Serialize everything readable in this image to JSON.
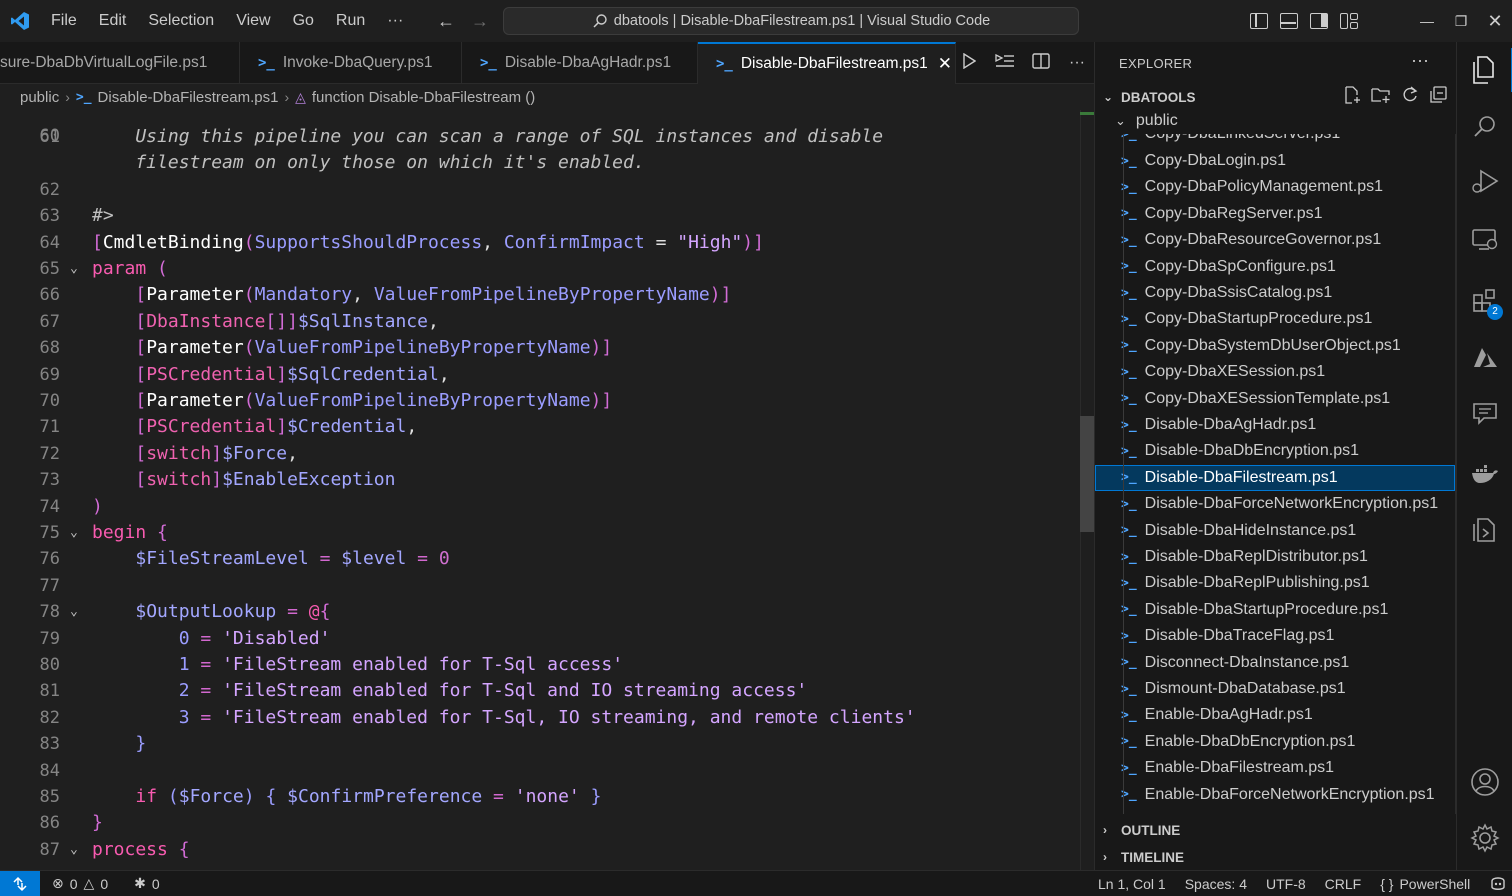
{
  "window": {
    "title": "dbatools | Disable-DbaFilestream.ps1 | Visual Studio Code",
    "menu": [
      "File",
      "Edit",
      "Selection",
      "View",
      "Go",
      "Run",
      "···"
    ]
  },
  "tabs": [
    {
      "label": "sure-DbaDbVirtualLogFile.ps1",
      "active": false
    },
    {
      "label": "Invoke-DbaQuery.ps1",
      "active": false
    },
    {
      "label": "Disable-DbaAgHadr.ps1",
      "active": false
    },
    {
      "label": "Disable-DbaFilestream.ps1",
      "active": true
    }
  ],
  "breadcrumb": {
    "folder": "public",
    "file": "Disable-DbaFilestream.ps1",
    "symbol": "function Disable-DbaFilestream ()"
  },
  "editor": {
    "partial_top_line": "60",
    "lines": [
      {
        "n": "61",
        "fold": false,
        "tokens": [
          [
            "c-comment",
            "    Using this pipeline you can scan a range of SQL instances and disable"
          ]
        ]
      },
      {
        "n": "",
        "fold": false,
        "tokens": [
          [
            "c-comment",
            "    filestream on only those on which it's enabled."
          ]
        ]
      },
      {
        "n": "62",
        "fold": false,
        "tokens": []
      },
      {
        "n": "63",
        "fold": false,
        "tokens": [
          [
            "c-comment",
            "#>"
          ]
        ]
      },
      {
        "n": "64",
        "fold": false,
        "tokens": [
          [
            "c-bracket",
            "["
          ],
          [
            "c-type",
            "CmdletBinding"
          ],
          [
            "c-bracket",
            "("
          ],
          [
            "c-attr",
            "SupportsShouldProcess"
          ],
          [
            "c-punct",
            ", "
          ],
          [
            "c-attr",
            "ConfirmImpact"
          ],
          [
            "c-punct",
            " = "
          ],
          [
            "c-str",
            "\"High\""
          ],
          [
            "c-bracket",
            ")]"
          ]
        ]
      },
      {
        "n": "65",
        "fold": true,
        "tokens": [
          [
            "c-kw",
            "param"
          ],
          [
            "c-punct",
            " "
          ],
          [
            "c-bracket",
            "("
          ]
        ]
      },
      {
        "n": "66",
        "fold": false,
        "tokens": [
          [
            "c-plain",
            "    "
          ],
          [
            "c-bracket",
            "["
          ],
          [
            "c-type",
            "Parameter"
          ],
          [
            "c-bracket",
            "("
          ],
          [
            "c-attr",
            "Mandatory"
          ],
          [
            "c-punct",
            ", "
          ],
          [
            "c-attr",
            "ValueFromPipelineByPropertyName"
          ],
          [
            "c-bracket",
            ")]"
          ]
        ]
      },
      {
        "n": "67",
        "fold": false,
        "tokens": [
          [
            "c-plain",
            "    "
          ],
          [
            "c-bracket",
            "["
          ],
          [
            "c-type2",
            "DbaInstance"
          ],
          [
            "c-bracket",
            "[]]"
          ],
          [
            "c-var",
            "$SqlInstance"
          ],
          [
            "c-punct",
            ","
          ]
        ]
      },
      {
        "n": "68",
        "fold": false,
        "tokens": [
          [
            "c-plain",
            "    "
          ],
          [
            "c-bracket",
            "["
          ],
          [
            "c-type",
            "Parameter"
          ],
          [
            "c-bracket",
            "("
          ],
          [
            "c-attr",
            "ValueFromPipelineByPropertyName"
          ],
          [
            "c-bracket",
            ")]"
          ]
        ]
      },
      {
        "n": "69",
        "fold": false,
        "tokens": [
          [
            "c-plain",
            "    "
          ],
          [
            "c-bracket",
            "["
          ],
          [
            "c-type2",
            "PSCredential"
          ],
          [
            "c-bracket",
            "]"
          ],
          [
            "c-var",
            "$SqlCredential"
          ],
          [
            "c-punct",
            ","
          ]
        ]
      },
      {
        "n": "70",
        "fold": false,
        "tokens": [
          [
            "c-plain",
            "    "
          ],
          [
            "c-bracket",
            "["
          ],
          [
            "c-type",
            "Parameter"
          ],
          [
            "c-bracket",
            "("
          ],
          [
            "c-attr",
            "ValueFromPipelineByPropertyName"
          ],
          [
            "c-bracket",
            ")]"
          ]
        ]
      },
      {
        "n": "71",
        "fold": false,
        "tokens": [
          [
            "c-plain",
            "    "
          ],
          [
            "c-bracket",
            "["
          ],
          [
            "c-type2",
            "PSCredential"
          ],
          [
            "c-bracket",
            "]"
          ],
          [
            "c-var",
            "$Credential"
          ],
          [
            "c-punct",
            ","
          ]
        ]
      },
      {
        "n": "72",
        "fold": false,
        "tokens": [
          [
            "c-plain",
            "    "
          ],
          [
            "c-bracket",
            "["
          ],
          [
            "c-type2",
            "switch"
          ],
          [
            "c-bracket",
            "]"
          ],
          [
            "c-var",
            "$Force"
          ],
          [
            "c-punct",
            ","
          ]
        ]
      },
      {
        "n": "73",
        "fold": false,
        "tokens": [
          [
            "c-plain",
            "    "
          ],
          [
            "c-bracket",
            "["
          ],
          [
            "c-type2",
            "switch"
          ],
          [
            "c-bracket",
            "]"
          ],
          [
            "c-var",
            "$EnableException"
          ]
        ]
      },
      {
        "n": "74",
        "fold": false,
        "tokens": [
          [
            "c-bracket",
            ")"
          ]
        ]
      },
      {
        "n": "75",
        "fold": true,
        "tokens": [
          [
            "c-kw",
            "begin"
          ],
          [
            "c-punct",
            " "
          ],
          [
            "c-bracket",
            "{"
          ]
        ]
      },
      {
        "n": "76",
        "fold": false,
        "tokens": [
          [
            "c-plain",
            "    "
          ],
          [
            "c-var",
            "$FileStreamLevel"
          ],
          [
            "c-op",
            " = "
          ],
          [
            "c-var",
            "$level"
          ],
          [
            "c-op",
            " = "
          ],
          [
            "c-num",
            "0"
          ]
        ]
      },
      {
        "n": "77",
        "fold": false,
        "tokens": []
      },
      {
        "n": "78",
        "fold": true,
        "tokens": [
          [
            "c-plain",
            "    "
          ],
          [
            "c-var",
            "$OutputLookup"
          ],
          [
            "c-op",
            " = "
          ],
          [
            "c-kw",
            "@"
          ],
          [
            "c-bracket",
            "{"
          ]
        ]
      },
      {
        "n": "79",
        "fold": false,
        "tokens": [
          [
            "c-plain",
            "        "
          ],
          [
            "c-attr",
            "0"
          ],
          [
            "c-op",
            " = "
          ],
          [
            "c-str",
            "'Disabled'"
          ]
        ]
      },
      {
        "n": "80",
        "fold": false,
        "tokens": [
          [
            "c-plain",
            "        "
          ],
          [
            "c-attr",
            "1"
          ],
          [
            "c-op",
            " = "
          ],
          [
            "c-str",
            "'FileStream enabled for T-Sql access'"
          ]
        ]
      },
      {
        "n": "81",
        "fold": false,
        "tokens": [
          [
            "c-plain",
            "        "
          ],
          [
            "c-attr",
            "2"
          ],
          [
            "c-op",
            " = "
          ],
          [
            "c-str",
            "'FileStream enabled for T-Sql and IO streaming access'"
          ]
        ]
      },
      {
        "n": "82",
        "fold": false,
        "tokens": [
          [
            "c-plain",
            "        "
          ],
          [
            "c-attr",
            "3"
          ],
          [
            "c-op",
            " = "
          ],
          [
            "c-str",
            "'FileStream enabled for T-Sql, IO streaming, and remote clients'"
          ]
        ]
      },
      {
        "n": "83",
        "fold": false,
        "tokens": [
          [
            "c-plain",
            "    "
          ],
          [
            "c-attr",
            "}"
          ]
        ]
      },
      {
        "n": "84",
        "fold": false,
        "tokens": []
      },
      {
        "n": "85",
        "fold": false,
        "tokens": [
          [
            "c-plain",
            "    "
          ],
          [
            "c-kw",
            "if"
          ],
          [
            "c-punct",
            " "
          ],
          [
            "c-attr",
            "("
          ],
          [
            "c-var",
            "$Force"
          ],
          [
            "c-attr",
            ")"
          ],
          [
            "c-punct",
            " "
          ],
          [
            "c-attr",
            "{"
          ],
          [
            "c-punct",
            " "
          ],
          [
            "c-var",
            "$ConfirmPreference"
          ],
          [
            "c-op",
            " = "
          ],
          [
            "c-str",
            "'none'"
          ],
          [
            "c-punct",
            " "
          ],
          [
            "c-attr",
            "}"
          ]
        ]
      },
      {
        "n": "86",
        "fold": false,
        "tokens": [
          [
            "c-bracket",
            "}"
          ]
        ]
      },
      {
        "n": "87",
        "fold": true,
        "tokens": [
          [
            "c-kw",
            "process"
          ],
          [
            "c-punct",
            " "
          ],
          [
            "c-bracket",
            "{"
          ]
        ]
      }
    ]
  },
  "explorer": {
    "header": "EXPLORER",
    "more": "···",
    "workspace": "DBATOOLS",
    "folder": "public",
    "partial_top_file": "Copy-DbaLinkedServer.ps1",
    "files": [
      "Copy-DbaLogin.ps1",
      "Copy-DbaPolicyManagement.ps1",
      "Copy-DbaRegServer.ps1",
      "Copy-DbaResourceGovernor.ps1",
      "Copy-DbaSpConfigure.ps1",
      "Copy-DbaSsisCatalog.ps1",
      "Copy-DbaStartupProcedure.ps1",
      "Copy-DbaSystemDbUserObject.ps1",
      "Copy-DbaXESession.ps1",
      "Copy-DbaXESessionTemplate.ps1",
      "Disable-DbaAgHadr.ps1",
      "Disable-DbaDbEncryption.ps1",
      "Disable-DbaFilestream.ps1",
      "Disable-DbaForceNetworkEncryption.ps1",
      "Disable-DbaHideInstance.ps1",
      "Disable-DbaReplDistributor.ps1",
      "Disable-DbaReplPublishing.ps1",
      "Disable-DbaStartupProcedure.ps1",
      "Disable-DbaTraceFlag.ps1",
      "Disconnect-DbaInstance.ps1",
      "Dismount-DbaDatabase.ps1",
      "Enable-DbaAgHadr.ps1",
      "Enable-DbaDbEncryption.ps1",
      "Enable-DbaFilestream.ps1",
      "Enable-DbaForceNetworkEncryption.ps1"
    ],
    "selected_file": "Disable-DbaFilestream.ps1",
    "outline": "OUTLINE",
    "timeline": "TIMELINE"
  },
  "activity": {
    "extensions_badge": "2"
  },
  "status": {
    "errors": "0",
    "warnings": "0",
    "ports": "0",
    "cursor": "Ln 1, Col 1",
    "spaces": "Spaces: 4",
    "encoding": "UTF-8",
    "eol": "CRLF",
    "language": "PowerShell"
  },
  "colors": {
    "accent": "#0078d4",
    "ps_icon": "#4fa6ff"
  }
}
